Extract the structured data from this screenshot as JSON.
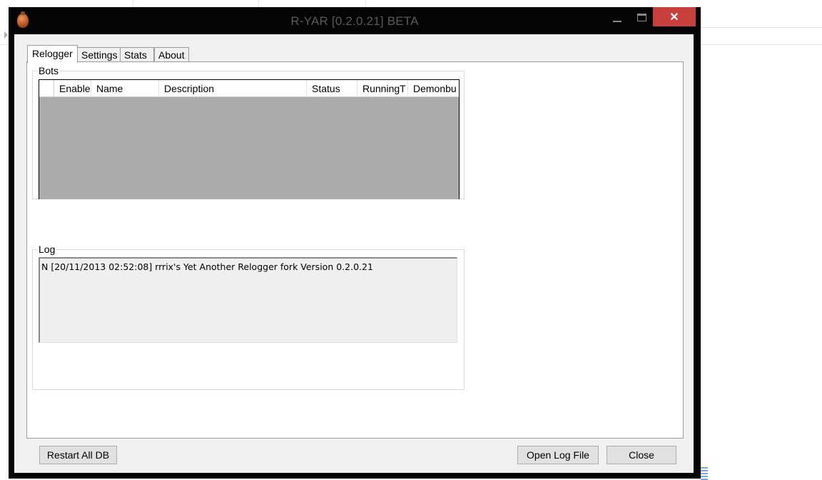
{
  "window": {
    "title": "R-YAR [0.2.0.21] BETA",
    "close_glyph": "✕"
  },
  "tabs": [
    {
      "label": "Relogger",
      "active": true
    },
    {
      "label": "Settings",
      "active": false
    },
    {
      "label": "Stats",
      "active": false
    },
    {
      "label": "About",
      "active": false
    }
  ],
  "bots": {
    "group_label": "Bots",
    "columns": [
      "Enable",
      "Name",
      "Description",
      "Status",
      "RunningT",
      "Demonbu"
    ]
  },
  "log": {
    "group_label": "Log",
    "lines": [
      "N [20/11/2013 02:52:08] rrrix's Yet Another Relogger fork Version 0.2.0.21"
    ]
  },
  "buttons": {
    "restart_all": "Restart All DB",
    "open_log": "Open Log File",
    "close": "Close"
  },
  "colors": {
    "window_frame": "#050505",
    "close_button": "#c7403b",
    "grid_background": "#ababab",
    "client_background": "#f0f0f0"
  },
  "icons": {
    "app": "grenade-icon",
    "minimize": "minimize-icon",
    "maximize": "maximize-icon",
    "close": "close-icon"
  }
}
